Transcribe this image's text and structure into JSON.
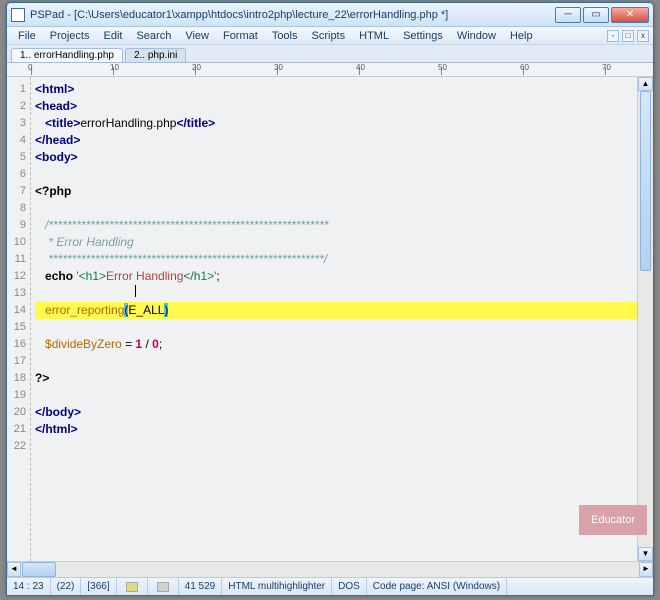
{
  "title": "PSPad - [C:\\Users\\educator1\\xampp\\htdocs\\intro2php\\lecture_22\\errorHandling.php *]",
  "menu": [
    "File",
    "Projects",
    "Edit",
    "Search",
    "View",
    "Format",
    "Tools",
    "Scripts",
    "HTML",
    "Settings",
    "Window",
    "Help"
  ],
  "tabs": [
    {
      "label": "1.. errorHandling.php",
      "active": true
    },
    {
      "label": "2.. php.ini",
      "active": false
    }
  ],
  "ruler_marks": [
    0,
    10,
    20,
    30,
    40,
    50,
    60,
    70
  ],
  "lines": [
    {
      "n": 1,
      "parts": [
        {
          "t": "<html>",
          "c": "tag"
        }
      ]
    },
    {
      "n": 2,
      "parts": [
        {
          "t": "<head>",
          "c": "tag"
        }
      ]
    },
    {
      "n": 3,
      "parts": [
        {
          "t": "   ",
          "c": ""
        },
        {
          "t": "<title>",
          "c": "tag"
        },
        {
          "t": "errorHandling.php",
          "c": ""
        },
        {
          "t": "</title>",
          "c": "tag"
        }
      ]
    },
    {
      "n": 4,
      "parts": [
        {
          "t": "</head>",
          "c": "tag"
        }
      ]
    },
    {
      "n": 5,
      "parts": [
        {
          "t": "<body>",
          "c": "tag"
        }
      ]
    },
    {
      "n": 6,
      "parts": []
    },
    {
      "n": 7,
      "parts": [
        {
          "t": "<?php",
          "c": "kw"
        }
      ]
    },
    {
      "n": 8,
      "parts": []
    },
    {
      "n": 9,
      "parts": [
        {
          "t": "   /************************************************************",
          "c": "cmt"
        }
      ]
    },
    {
      "n": 10,
      "parts": [
        {
          "t": "    * Error Handling",
          "c": "cmt"
        }
      ]
    },
    {
      "n": 11,
      "parts": [
        {
          "t": "    ***********************************************************/",
          "c": "cmt"
        }
      ]
    },
    {
      "n": 12,
      "parts": [
        {
          "t": "   ",
          "c": ""
        },
        {
          "t": "echo",
          "c": "kw"
        },
        {
          "t": " ",
          "c": ""
        },
        {
          "t": "'",
          "c": "str"
        },
        {
          "t": "<h1>",
          "c": "strtag"
        },
        {
          "t": "Error Handling",
          "c": "str"
        },
        {
          "t": "</h1>",
          "c": "strtag"
        },
        {
          "t": "'",
          "c": "str"
        },
        {
          "t": ";",
          "c": ""
        }
      ]
    },
    {
      "n": 13,
      "parts": []
    },
    {
      "n": 14,
      "highlight": true,
      "parts": [
        {
          "t": "   ",
          "c": ""
        },
        {
          "t": "error_reporting",
          "c": "func"
        },
        {
          "t": "(",
          "c": "match"
        },
        {
          "t": "E_ALL",
          "c": ""
        },
        {
          "t": ")",
          "c": "match"
        }
      ]
    },
    {
      "n": 15,
      "parts": []
    },
    {
      "n": 16,
      "parts": [
        {
          "t": "   ",
          "c": ""
        },
        {
          "t": "$divideByZero",
          "c": "var"
        },
        {
          "t": " = ",
          "c": ""
        },
        {
          "t": "1",
          "c": "num"
        },
        {
          "t": " / ",
          "c": ""
        },
        {
          "t": "0",
          "c": "num"
        },
        {
          "t": ";",
          "c": ""
        }
      ]
    },
    {
      "n": 17,
      "parts": []
    },
    {
      "n": 18,
      "parts": [
        {
          "t": "?>",
          "c": "kw"
        }
      ]
    },
    {
      "n": 19,
      "parts": []
    },
    {
      "n": 20,
      "parts": [
        {
          "t": "</body>",
          "c": "tag"
        }
      ]
    },
    {
      "n": 21,
      "parts": [
        {
          "t": "</html>",
          "c": "tag"
        }
      ]
    },
    {
      "n": 22,
      "parts": []
    }
  ],
  "cursor_mark_line": 13,
  "status": {
    "pos": "14 : 23",
    "sel": "(22)",
    "total": "[366]",
    "col": "41  529",
    "highlighter": "HTML multihighlighter",
    "eol": "DOS",
    "codepage": "Code page: ANSI (Windows)"
  },
  "watermark": "Educator"
}
